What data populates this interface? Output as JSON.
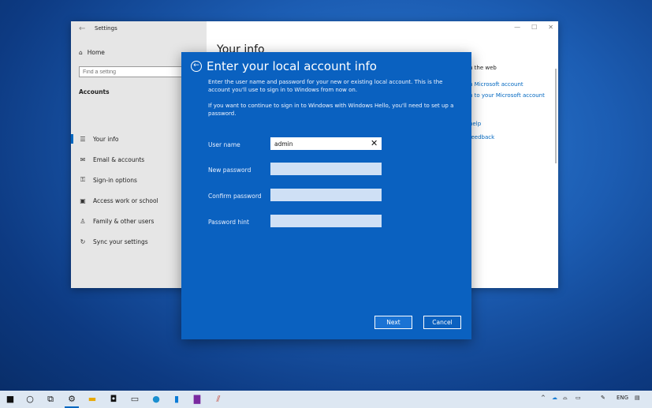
{
  "settings": {
    "title": "Settings",
    "back": "←",
    "controls": [
      "—",
      "☐",
      "✕"
    ],
    "home_label": "Home",
    "search_placeholder": "Find a setting",
    "section": "Accounts",
    "nav": [
      {
        "icon": "person-list",
        "label": "Your info"
      },
      {
        "icon": "mail",
        "label": "Email & accounts"
      },
      {
        "icon": "key",
        "label": "Sign-in options"
      },
      {
        "icon": "briefcase",
        "label": "Access work or school"
      },
      {
        "icon": "person",
        "label": "Family & other users"
      },
      {
        "icon": "sync",
        "label": "Sync your settings"
      }
    ],
    "main_title": "Your info",
    "right_pane": {
      "heading": "n the web",
      "link1": "n Microsoft account",
      "link2": "n to your Microsoft account",
      "link3": "help",
      "link4": "feedback"
    }
  },
  "dialog": {
    "title": "Enter your local account info",
    "p1": "Enter the user name and password for your new or existing local account. This is the account you'll use to sign in to Windows from now on.",
    "p2": "If you want to continue to sign in to Windows with Windows Hello, you'll need to set up a password.",
    "fields": {
      "username_label": "User name",
      "username_value": "admin",
      "new_password_label": "New password",
      "confirm_password_label": "Confirm password",
      "hint_label": "Password hint"
    },
    "clear_glyph": "✕",
    "next": "Next",
    "cancel": "Cancel"
  },
  "taskbar": {
    "tray": {
      "language": "ENG"
    }
  }
}
